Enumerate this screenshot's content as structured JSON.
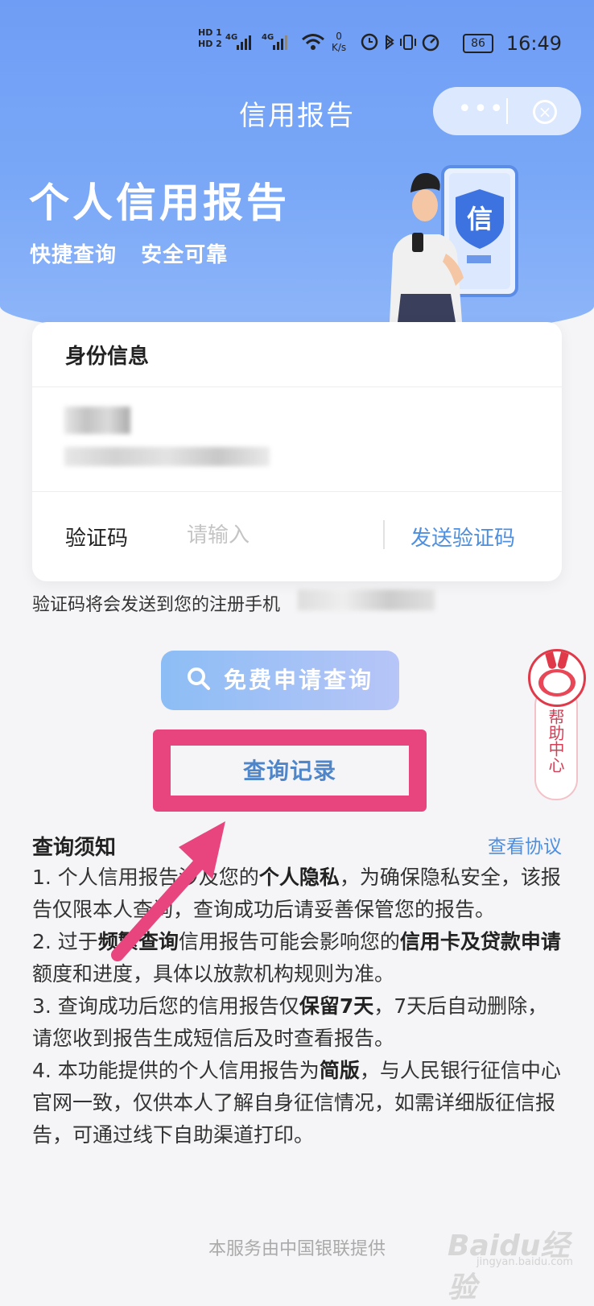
{
  "status_bar": {
    "hd1": "HD 1",
    "hd2": "HD 2",
    "network1": "4G",
    "network2": "4G",
    "speed_value": "0",
    "speed_unit": "K/s",
    "battery": "86",
    "time": "16:49"
  },
  "nav": {
    "title": "信用报告",
    "more_label": "•••",
    "close_label": "×"
  },
  "hero": {
    "title": "个人信用报告",
    "subtitle": "快捷查询   安全可靠",
    "badge_char": "信"
  },
  "identity": {
    "section_title": "身份信息",
    "code_label": "验证码",
    "code_placeholder": "请输入",
    "send_code": "发送验证码"
  },
  "hint": "验证码将会发送到您的注册手机",
  "apply_button": "免费申请查询",
  "history_link": "查询记录",
  "help_center": "帮助中心",
  "notice": {
    "title": "查询须知",
    "view_agreement": "查看协议",
    "items": [
      {
        "pre": "1. 个人信用报告涉及您的",
        "bold": "个人隐私",
        "post": "，为确保隐私安全，该报告仅限本人查询，查询成功后请妥善保管您的报告。"
      },
      {
        "pre": "2. 过于",
        "bold": "频繁查询",
        "mid": "信用报告可能会影响您的",
        "bold2": "信用卡及贷款申请",
        "post": "额度和进度，具体以放款机构规则为准。"
      },
      {
        "pre": "3. 查询成功后您的信用报告仅",
        "bold": "保留7天",
        "post": "，7天后自动删除，请您收到报告生成短信后及时查看报告。"
      },
      {
        "pre": "4. 本功能提供的个人信用报告为",
        "bold": "简版",
        "post": "，与人民银行征信中心官网一致，仅供本人了解自身征信情况，如需详细版征信报告，可通过线下自助渠道打印。"
      }
    ]
  },
  "footer": "本服务由中国银联提供",
  "watermark": "Baidu经验",
  "watermark_sub": "jingyan.baidu.com",
  "colors": {
    "header_blue": "#7aa8f7",
    "link_blue": "#4e8fdf",
    "highlight_pink": "#e8457e"
  }
}
